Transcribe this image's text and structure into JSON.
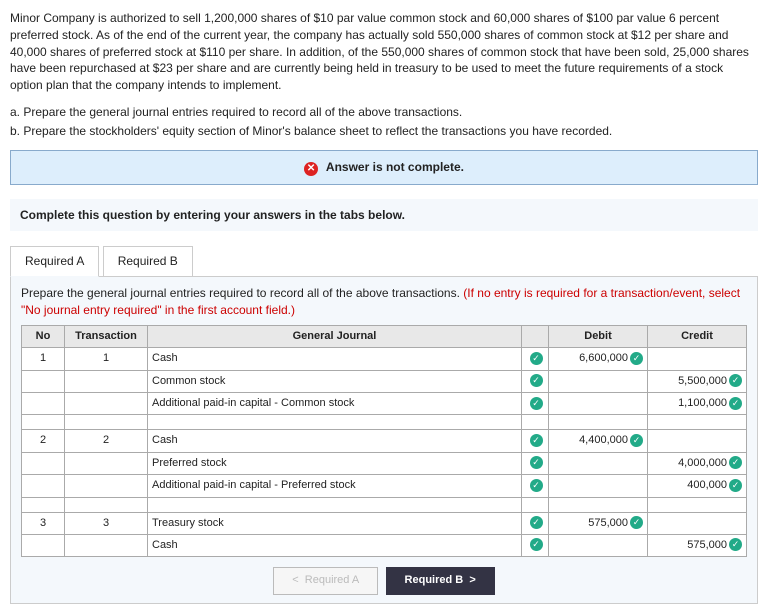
{
  "intro": "Minor Company is authorized to sell 1,200,000 shares of $10 par value common stock and 60,000 shares of $100 par value 6 percent preferred stock. As of the end of the current year, the company has actually sold 550,000 shares of common stock at $12 per share and 40,000 shares of preferred stock at $110 per share. In addition, of the 550,000 shares of common stock that have been sold, 25,000 shares have been repurchased at $23 per share and are currently being held in treasury to be used to meet the future requirements of a stock option plan that the company intends to implement.",
  "parts": {
    "a": "a. Prepare the general journal entries required to record all of the above transactions.",
    "b": "b. Prepare the stockholders' equity section of Minor's balance sheet to reflect the transactions you have recorded."
  },
  "alert": "Answer is not complete.",
  "tab_instructions": "Complete this question by entering your answers in the tabs below.",
  "tabs": {
    "a": "Required A",
    "b": "Required B"
  },
  "panel": {
    "text1": "Prepare the general journal entries required to record all of the above transactions. ",
    "text2": "(If no entry is required for a transaction/event, select \"No journal entry required\" in the first account field.)"
  },
  "headers": {
    "no": "No",
    "txn": "Transaction",
    "gj": "General Journal",
    "debit": "Debit",
    "credit": "Credit"
  },
  "rows": [
    {
      "no": "1",
      "txn": "1",
      "acct": "Cash",
      "indent": false,
      "debit": "6,600,000",
      "credit": ""
    },
    {
      "no": "",
      "txn": "",
      "acct": "Common stock",
      "indent": true,
      "debit": "",
      "credit": "5,500,000"
    },
    {
      "no": "",
      "txn": "",
      "acct": "Additional paid-in capital - Common stock",
      "indent": true,
      "debit": "",
      "credit": "1,100,000"
    },
    {
      "spacer": true
    },
    {
      "no": "2",
      "txn": "2",
      "acct": "Cash",
      "indent": false,
      "debit": "4,400,000",
      "credit": ""
    },
    {
      "no": "",
      "txn": "",
      "acct": "Preferred stock",
      "indent": true,
      "debit": "",
      "credit": "4,000,000"
    },
    {
      "no": "",
      "txn": "",
      "acct": "Additional paid-in capital - Preferred stock",
      "indent": true,
      "debit": "",
      "credit": "400,000"
    },
    {
      "spacer": true
    },
    {
      "no": "3",
      "txn": "3",
      "acct": "Treasury stock",
      "indent": false,
      "debit": "575,000",
      "credit": ""
    },
    {
      "no": "",
      "txn": "",
      "acct": "Cash",
      "indent": true,
      "debit": "",
      "credit": "575,000"
    }
  ],
  "nav": {
    "prev": "Required A",
    "next": "Required B"
  },
  "glyph": {
    "lt": "<",
    "gt": ">",
    "x": "✕",
    "chk": "✓"
  }
}
